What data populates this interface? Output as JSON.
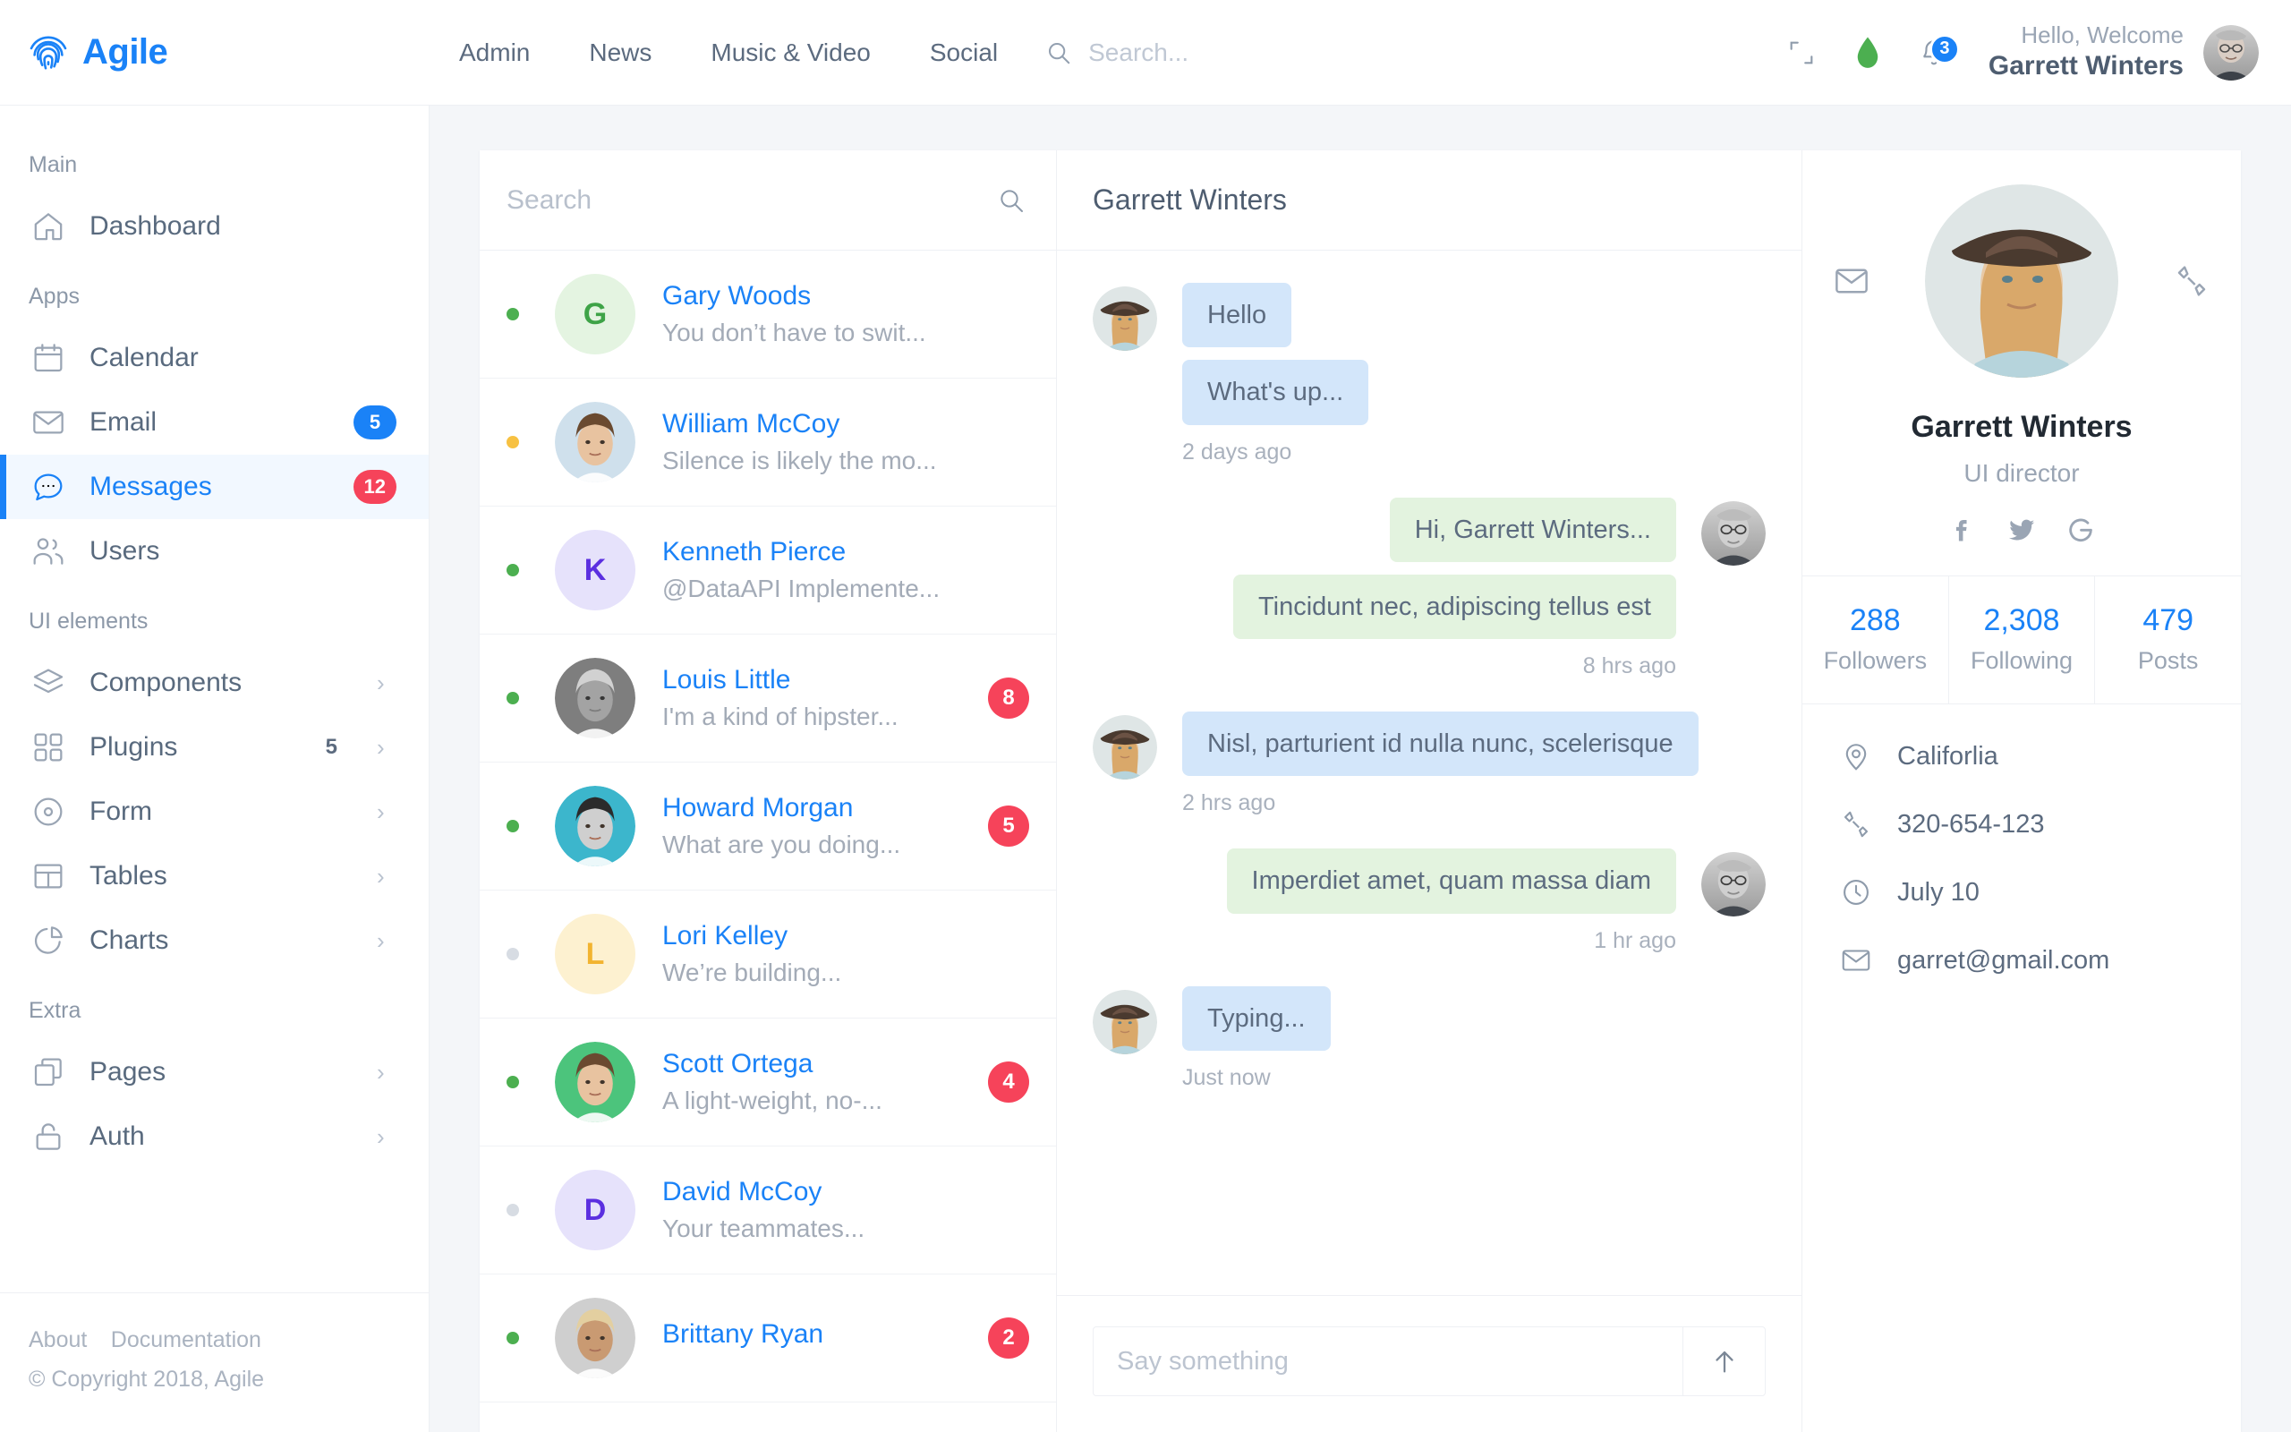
{
  "brand": {
    "name": "Agile",
    "logo_icon": "fingerprint-icon"
  },
  "topnav": {
    "items": [
      {
        "label": "Admin"
      },
      {
        "label": "News"
      },
      {
        "label": "Music & Video"
      },
      {
        "label": "Social"
      }
    ],
    "search": {
      "placeholder": "Search...",
      "icon": "search-icon"
    }
  },
  "topbar_right": {
    "fullscreen_icon": "expand-collapse-icon",
    "status_icon": "green-drop-icon",
    "status_color": "#4caf50",
    "bell_icon": "bell-icon",
    "bell_count": "3",
    "greeting": "Hello, Welcome",
    "user_name": "Garrett Winters",
    "avatar_icon": "user-avatar"
  },
  "sidebar": {
    "groups": [
      {
        "title": "Main",
        "items": [
          {
            "label": "Dashboard",
            "icon": "home-icon",
            "badge": "",
            "badge_color": "",
            "count": "",
            "chevron": false,
            "active": false
          }
        ]
      },
      {
        "title": "Apps",
        "items": [
          {
            "label": "Calendar",
            "icon": "calendar-icon",
            "badge": "",
            "badge_color": "",
            "count": "",
            "chevron": false,
            "active": false
          },
          {
            "label": "Email",
            "icon": "envelope-icon",
            "badge": "5",
            "badge_color": "#1a82f7",
            "count": "",
            "chevron": false,
            "active": false
          },
          {
            "label": "Messages",
            "icon": "chat-bubble-icon",
            "badge": "12",
            "badge_color": "#f6435a",
            "count": "",
            "chevron": false,
            "active": true
          },
          {
            "label": "Users",
            "icon": "users-icon",
            "badge": "",
            "badge_color": "",
            "count": "",
            "chevron": false,
            "active": false
          }
        ]
      },
      {
        "title": "UI elements",
        "items": [
          {
            "label": "Components",
            "icon": "layers-icon",
            "badge": "",
            "badge_color": "",
            "count": "",
            "chevron": true,
            "active": false
          },
          {
            "label": "Plugins",
            "icon": "grid-icon",
            "badge": "",
            "badge_color": "",
            "count": "5",
            "chevron": true,
            "active": false
          },
          {
            "label": "Form",
            "icon": "radio-circle-icon",
            "badge": "",
            "badge_color": "",
            "count": "",
            "chevron": true,
            "active": false
          },
          {
            "label": "Tables",
            "icon": "table-icon",
            "badge": "",
            "badge_color": "",
            "count": "",
            "chevron": true,
            "active": false
          },
          {
            "label": "Charts",
            "icon": "pie-chart-icon",
            "badge": "",
            "badge_color": "",
            "count": "",
            "chevron": true,
            "active": false
          }
        ]
      },
      {
        "title": "Extra",
        "items": [
          {
            "label": "Pages",
            "icon": "copy-pages-icon",
            "badge": "",
            "badge_color": "",
            "count": "",
            "chevron": true,
            "active": false
          },
          {
            "label": "Auth",
            "icon": "lock-icon",
            "badge": "",
            "badge_color": "",
            "count": "",
            "chevron": true,
            "active": false
          }
        ]
      }
    ],
    "footer": {
      "about": "About",
      "documentation": "Documentation",
      "copyright": "© Copyright 2018, Agile"
    }
  },
  "conversation_list": {
    "search": {
      "placeholder": "Search",
      "value": "",
      "icon": "search-icon"
    },
    "items": [
      {
        "name": "Gary Woods",
        "preview": "You don’t have to swit...",
        "status": "online",
        "unread": "",
        "avatar_type": "initial",
        "initial": "G",
        "bg": "#e4f4e1",
        "fg": "#3ea347"
      },
      {
        "name": "William McCoy",
        "preview": "Silence is likely the mo...",
        "status": "away",
        "unread": "",
        "avatar_type": "photo",
        "initial": "",
        "bg": "#cfe0ec",
        "fg": ""
      },
      {
        "name": "Kenneth Pierce",
        "preview": "@DataAPI Implemente...",
        "status": "online",
        "unread": "",
        "avatar_type": "initial",
        "initial": "K",
        "bg": "#e6e2fb",
        "fg": "#5b2fe0"
      },
      {
        "name": "Louis Little",
        "preview": "I'm a kind of hipster...",
        "status": "online",
        "unread": "8",
        "avatar_type": "photo",
        "initial": "",
        "bg": "#7e7e7e",
        "fg": ""
      },
      {
        "name": "Howard Morgan",
        "preview": "What are you doing...",
        "status": "online",
        "unread": "5",
        "avatar_type": "photo",
        "initial": "",
        "bg": "#3cb6cc",
        "fg": ""
      },
      {
        "name": "Lori Kelley",
        "preview": "We’re building...",
        "status": "offline",
        "unread": "",
        "avatar_type": "initial",
        "initial": "L",
        "bg": "#fdf1d0",
        "fg": "#f2b430"
      },
      {
        "name": "Scott Ortega",
        "preview": "A light-weight, no-...",
        "status": "online",
        "unread": "4",
        "avatar_type": "photo",
        "initial": "",
        "bg": "#4cc47c",
        "fg": ""
      },
      {
        "name": "David McCoy",
        "preview": "Your teammates...",
        "status": "offline",
        "unread": "",
        "avatar_type": "initial",
        "initial": "D",
        "bg": "#e6e2fb",
        "fg": "#5b2fe0"
      },
      {
        "name": "Brittany Ryan",
        "preview": "",
        "status": "online",
        "unread": "2",
        "avatar_type": "photo",
        "initial": "",
        "bg": "#cfcfcf",
        "fg": ""
      }
    ]
  },
  "chat": {
    "title": "Garrett Winters",
    "groups": [
      {
        "side": "in",
        "avatar": "woman-hat-avatar",
        "bubbles": [
          "Hello",
          "What's up..."
        ],
        "time": "2 days ago"
      },
      {
        "side": "out",
        "avatar": "man-glasses-avatar",
        "bubbles": [
          "Hi, Garrett Winters...",
          "Tincidunt nec, adipiscing tellus est"
        ],
        "time": "8 hrs ago"
      },
      {
        "side": "in",
        "avatar": "woman-hat-avatar",
        "bubbles": [
          "Nisl, parturient id nulla nunc, scelerisque"
        ],
        "time": "2 hrs ago"
      },
      {
        "side": "out",
        "avatar": "man-glasses-avatar",
        "bubbles": [
          "Imperdiet amet, quam massa diam"
        ],
        "time": "1 hr ago"
      },
      {
        "side": "in",
        "avatar": "woman-hat-avatar",
        "bubbles": [
          "Typing..."
        ],
        "time": "Just now"
      }
    ],
    "composer": {
      "placeholder": "Say something",
      "value": "",
      "send_icon": "arrow-up-icon"
    },
    "bubble_in_color": "#d3e6fa",
    "bubble_out_color": "#e3f3df"
  },
  "profile": {
    "mail_icon": "envelope-icon",
    "link_icon": "phone-handset-icon",
    "avatar": "woman-hat-avatar",
    "name": "Garrett Winters",
    "role": "UI director",
    "socials": [
      {
        "name": "facebook-icon"
      },
      {
        "name": "twitter-icon"
      },
      {
        "name": "google-icon"
      }
    ],
    "stats": [
      {
        "value": "288",
        "label": "Followers"
      },
      {
        "value": "2,308",
        "label": "Following"
      },
      {
        "value": "479",
        "label": "Posts"
      }
    ],
    "info": [
      {
        "icon": "location-pin-icon",
        "text": "Califorlia"
      },
      {
        "icon": "phone-handset-icon",
        "text": "320-654-123"
      },
      {
        "icon": "clock-icon",
        "text": "July 10"
      },
      {
        "icon": "envelope-icon",
        "text": "garret@gmail.com"
      }
    ],
    "accent_color": "#1a82f7"
  }
}
